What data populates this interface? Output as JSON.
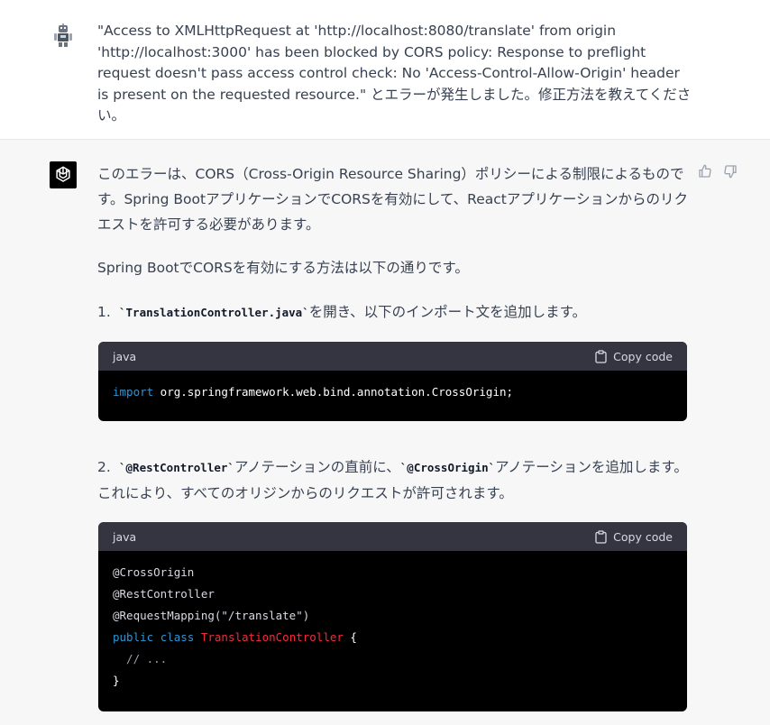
{
  "user": {
    "message": "\"Access to XMLHttpRequest at 'http://localhost:8080/translate' from origin 'http://localhost:3000' has been blocked by CORS policy: Response to preflight request doesn't pass access control check: No 'Access-Control-Allow-Origin' header is present on the requested resource.\" とエラーが発生しました。修正方法を教えてください。"
  },
  "assistant": {
    "intro": "このエラーは、CORS（Cross-Origin Resource Sharing）ポリシーによる制限によるものです。Spring BootアプリケーションでCORSを有効にして、Reactアプリケーションからのリクエストを許可する必要があります。",
    "how_to": "Spring BootでCORSを有効にする方法は以下の通りです。",
    "step1": {
      "num": "1.",
      "code": "`TranslationController.java`",
      "text": "を開き、以下のインポート文を追加します。"
    },
    "code1": {
      "lang": "java",
      "copy_label": "Copy code",
      "keyword": "import",
      "rest": " org.springframework.web.bind.annotation.CrossOrigin;"
    },
    "step2": {
      "num": "2.",
      "code_a": "`@RestController`",
      "text_a": "アノテーションの直前に、",
      "code_b": "`@CrossOrigin`",
      "text_b": "アノテーションを追加します。これにより、すべてのオリジンからのリクエストが許可されます。"
    },
    "code2": {
      "lang": "java",
      "copy_label": "Copy code",
      "line1": "@CrossOrigin",
      "line2": "@RestController",
      "line3": "@RequestMapping(\"/translate\")",
      "kw_public": "public",
      "kw_class": "class",
      "class_name": "TranslationController",
      "brace_open": " {",
      "comment": "  // ...",
      "brace_close": "}"
    }
  }
}
